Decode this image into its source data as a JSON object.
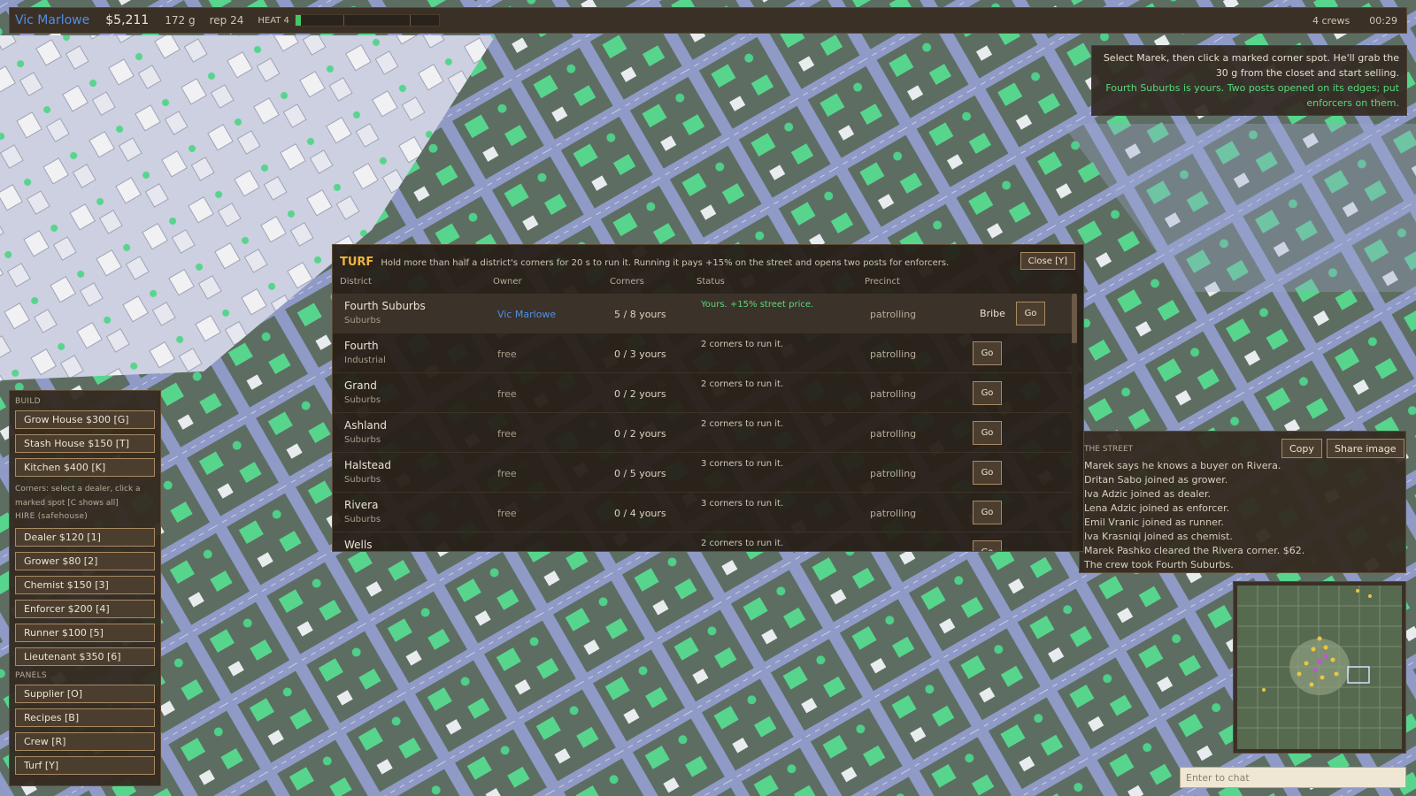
{
  "topbar": {
    "player_name": "Vic Marlowe",
    "cash": "$5,211",
    "product": "172 g",
    "reputation": "rep 24",
    "heat_label": "HEAT 4",
    "heat_level": 0.04,
    "crews": "4 crews",
    "clock": "00:29"
  },
  "hint": {
    "line1": "Select Marek, then click a marked corner spot. He'll grab the 30 g from the closet and start selling.",
    "line2": "Fourth Suburbs is yours. Two posts opened on its edges; put enforcers on them."
  },
  "build": {
    "section_build": "BUILD",
    "build_items": [
      {
        "label": "Grow House  $300  [G]"
      },
      {
        "label": "Stash House  $150  [T]"
      },
      {
        "label": "Kitchen  $400  [K]"
      }
    ],
    "corners_note": "Corners: select a dealer, click a marked spot  [C shows all]",
    "section_hire": "HIRE (safehouse)",
    "hire_items": [
      {
        "label": "Dealer  $120  [1]"
      },
      {
        "label": "Grower  $80  [2]"
      },
      {
        "label": "Chemist  $150  [3]"
      },
      {
        "label": "Enforcer  $200  [4]"
      },
      {
        "label": "Runner  $100  [5]"
      },
      {
        "label": "Lieutenant  $350  [6]"
      }
    ],
    "section_panels": "PANELS",
    "panel_items": [
      {
        "label": "Supplier  [O]"
      },
      {
        "label": "Recipes  [B]"
      },
      {
        "label": "Crew  [R]"
      },
      {
        "label": "Turf  [Y]"
      }
    ]
  },
  "turf": {
    "title": "TURF",
    "description": "Hold more than half a district's corners for 20 s to run it. Running it pays +15% on the street and opens two posts for enforcers.",
    "close_label": "Close [Y]",
    "columns": {
      "district": "District",
      "owner": "Owner",
      "corners": "Corners",
      "status": "Status",
      "precinct": "Precinct"
    },
    "go_label": "Go",
    "bribe_label": "Bribe",
    "rows": [
      {
        "name": "Fourth Suburbs",
        "type": "Suburbs",
        "owner": "Vic Marlowe",
        "corners": "5 / 8 yours",
        "status": "Yours. +15% street price.",
        "precinct": "patrolling"
      },
      {
        "name": "Fourth",
        "type": "Industrial",
        "owner": "free",
        "corners": "0 / 3 yours",
        "status": "2 corners to run it.",
        "precinct": "patrolling"
      },
      {
        "name": "Grand",
        "type": "Suburbs",
        "owner": "free",
        "corners": "0 / 2 yours",
        "status": "2 corners to run it.",
        "precinct": "patrolling"
      },
      {
        "name": "Ashland",
        "type": "Suburbs",
        "owner": "free",
        "corners": "0 / 2 yours",
        "status": "2 corners to run it.",
        "precinct": "patrolling"
      },
      {
        "name": "Halstead",
        "type": "Suburbs",
        "owner": "free",
        "corners": "0 / 5 yours",
        "status": "3 corners to run it.",
        "precinct": "patrolling"
      },
      {
        "name": "Rivera",
        "type": "Suburbs",
        "owner": "free",
        "corners": "0 / 4 yours",
        "status": "3 corners to run it.",
        "precinct": "patrolling"
      },
      {
        "name": "Wells",
        "type": "",
        "owner": "",
        "corners": "",
        "status": "2 corners to run it.",
        "precinct": ""
      }
    ]
  },
  "street": {
    "title": "THE STREET",
    "copy_label": "Copy",
    "share_label": "Share image",
    "log": [
      "Marek says he knows a buyer on Rivera.",
      "Dritan Sabo joined as grower.",
      "Iva Adzic joined as dealer.",
      "Lena Adzic joined as enforcer.",
      "Emil Vranic joined as runner.",
      "Iva Krasniqi joined as chemist.",
      "Marek Pashko cleared the Rivera corner. $62.",
      "The crew took Fourth Suburbs."
    ]
  },
  "chat": {
    "placeholder": "Enter to chat"
  },
  "colors": {
    "player_blue": "#4f8fe6",
    "turf_gold": "#f0b537",
    "status_green": "#59d97a",
    "panel_brown": "#3a3026",
    "grass": "#5f6f62",
    "road": "#8e99c6",
    "house_roof": "#5cd88f"
  }
}
